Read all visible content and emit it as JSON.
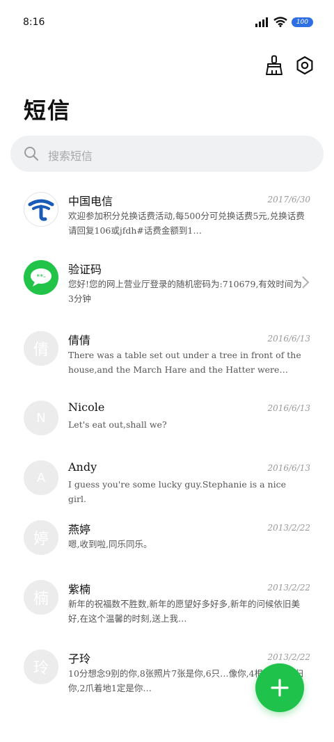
{
  "status_bar": {
    "time": "8:16",
    "battery": "100"
  },
  "header": {
    "title": "短信"
  },
  "search": {
    "placeholder": "搜索短信"
  },
  "colors": {
    "accent_green": "#1fc24a",
    "telecom_blue": "#1a5bb8",
    "battery_blue": "#2f6fe4"
  },
  "messages": [
    {
      "avatar": "",
      "name": "中国电信",
      "date": "2017/6/30",
      "preview": "欢迎参加积分兑换话费活动,每500分可兑换话费5元,兑换话费请回复106或jfdh#话费金额到1…",
      "icon": "china-telecom-logo"
    },
    {
      "avatar": "**-",
      "name": "验证码",
      "date": "",
      "preview": "您好!您的网上营业厅登录的随机密码为:710679,有效时间为3分钟",
      "icon": "message-bubble-icon"
    },
    {
      "avatar": "倩",
      "name": "倩倩",
      "date": "2016/6/13",
      "preview": "There was a table set out under a tree in front of the house,and the March Hare and the Hatter were having t…"
    },
    {
      "avatar": "N",
      "name": "Nicole",
      "date": "2016/6/13",
      "preview": "Let's eat out,shall we?"
    },
    {
      "avatar": "A",
      "name": "Andy",
      "date": "2016/6/13",
      "preview": "I guess you're some lucky guy.Stephanie is a nice girl."
    },
    {
      "avatar": "婷",
      "name": "燕婷",
      "date": "2013/2/22",
      "preview": "嗯,收到啦,同乐同乐。"
    },
    {
      "avatar": "楠",
      "name": "紫楠",
      "date": "2013/2/22",
      "preview": "新年的祝福数不胜数,新年的愿望好多好多,新年的问候依旧美好,在这个温馨的时刻,送上我…"
    },
    {
      "avatar": "玲",
      "name": "子玲",
      "date": "2013/2/22",
      "preview": "10分想念9别的你,8张照片7张是你,6只…像你,4根骨头3根归你,2爪着地1定是你…"
    }
  ]
}
